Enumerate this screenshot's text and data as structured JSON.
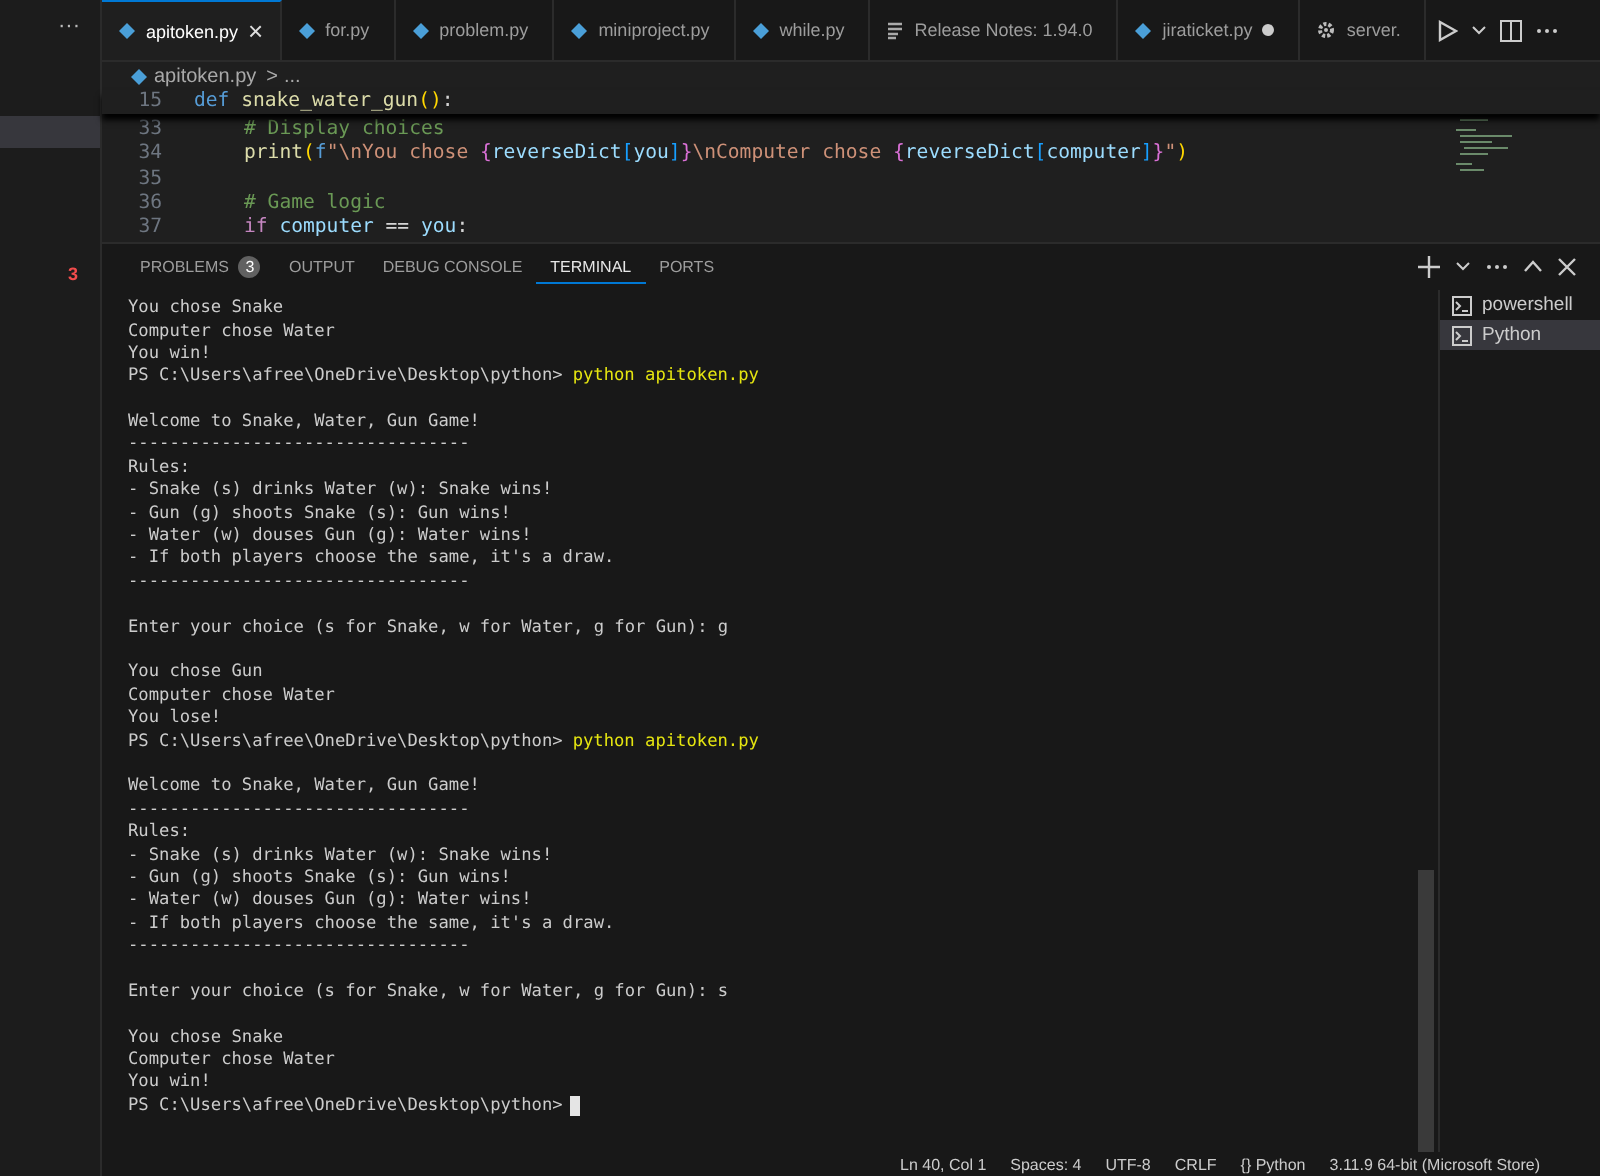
{
  "sidebar": {
    "more": "···",
    "badge": "3"
  },
  "tabs": [
    {
      "label": "apitoken.py",
      "kind": "python",
      "selected": true,
      "modified": false,
      "closable": true,
      "close": "×"
    },
    {
      "label": "for.py",
      "kind": "python",
      "selected": false,
      "modified": false,
      "closable": false
    },
    {
      "label": "problem.py",
      "kind": "python",
      "selected": false,
      "modified": false,
      "closable": false
    },
    {
      "label": "miniproject.py",
      "kind": "python",
      "selected": false,
      "modified": false,
      "closable": false
    },
    {
      "label": "while.py",
      "kind": "python",
      "selected": false,
      "modified": false,
      "closable": false
    },
    {
      "label": "Release Notes: 1.94.0",
      "kind": "notes",
      "selected": false,
      "modified": false,
      "closable": false
    },
    {
      "label": "jiraticket.py",
      "kind": "python",
      "selected": false,
      "modified": true,
      "closable": false
    },
    {
      "label": "server.",
      "kind": "settings",
      "selected": false,
      "modified": false,
      "closable": false
    }
  ],
  "breadcrumb": {
    "file": "apitoken.py",
    "separator": ">",
    "rest": "..."
  },
  "code_lines": [
    {
      "number": "15",
      "sticky": true,
      "indented": false,
      "tokens": [
        {
          "kind": "keyword",
          "text": "def "
        },
        {
          "kind": "function",
          "text": "snake_water_gun"
        },
        {
          "kind": "bracket",
          "text": "()"
        },
        {
          "kind": "plain",
          "text": ":"
        }
      ]
    },
    {
      "number": "33",
      "sticky": false,
      "indented": true,
      "tokens": [
        {
          "kind": "comment",
          "text": "# Display choices"
        }
      ]
    },
    {
      "number": "34",
      "sticky": false,
      "indented": true,
      "tokens": [
        {
          "kind": "function",
          "text": "print"
        },
        {
          "kind": "bracket",
          "text": "("
        },
        {
          "kind": "keyword",
          "text": "f"
        },
        {
          "kind": "string",
          "text": "\"\\nYou chose "
        },
        {
          "kind": "brace",
          "text": "{"
        },
        {
          "kind": "variable",
          "text": "reverseDict"
        },
        {
          "kind": "bracket2",
          "text": "["
        },
        {
          "kind": "variable",
          "text": "you"
        },
        {
          "kind": "bracket2",
          "text": "]"
        },
        {
          "kind": "brace",
          "text": "}"
        },
        {
          "kind": "string",
          "text": "\\nComputer chose "
        },
        {
          "kind": "brace",
          "text": "{"
        },
        {
          "kind": "variable",
          "text": "reverseDict"
        },
        {
          "kind": "bracket2",
          "text": "["
        },
        {
          "kind": "variable",
          "text": "computer"
        },
        {
          "kind": "bracket2",
          "text": "]"
        },
        {
          "kind": "brace",
          "text": "}"
        },
        {
          "kind": "string",
          "text": "\""
        },
        {
          "kind": "bracket",
          "text": ")"
        }
      ]
    },
    {
      "number": "35",
      "sticky": false
    },
    {
      "number": "36",
      "sticky": false,
      "indented": true,
      "tokens": [
        {
          "kind": "comment",
          "text": "# Game logic"
        }
      ]
    },
    {
      "number": "37",
      "sticky": false,
      "indented": true,
      "tokens": [
        {
          "kind": "control",
          "text": "if "
        },
        {
          "kind": "variable",
          "text": "computer"
        },
        {
          "kind": "plain",
          "text": " == "
        },
        {
          "kind": "variable",
          "text": "you"
        },
        {
          "kind": "plain",
          "text": ":"
        }
      ]
    }
  ],
  "panel_tabs": [
    {
      "label": "PROBLEMS",
      "count": "3",
      "selected": false
    },
    {
      "label": "OUTPUT",
      "selected": false
    },
    {
      "label": "DEBUG CONSOLE",
      "selected": false
    },
    {
      "label": "TERMINAL",
      "selected": true
    },
    {
      "label": "PORTS",
      "selected": false
    }
  ],
  "terminal": {
    "cursor": true,
    "lines": [
      {
        "kind": "text",
        "text": "You chose Snake"
      },
      {
        "kind": "text",
        "text": "Computer chose Water"
      },
      {
        "kind": "text",
        "text": "You win!"
      },
      {
        "kind": "prompt",
        "text": "PS C:\\Users\\afree\\OneDrive\\Desktop\\python>",
        "command": "python apitoken.py"
      },
      {
        "kind": "blank"
      },
      {
        "kind": "text",
        "text": "Welcome to Snake, Water, Gun Game!"
      },
      {
        "kind": "text",
        "text": "---------------------------------"
      },
      {
        "kind": "text",
        "text": "Rules:"
      },
      {
        "kind": "text",
        "text": "- Snake (s) drinks Water (w): Snake wins!"
      },
      {
        "kind": "text",
        "text": "- Gun (g) shoots Snake (s): Gun wins!"
      },
      {
        "kind": "text",
        "text": "- Water (w) douses Gun (g): Water wins!"
      },
      {
        "kind": "text",
        "text": "- If both players choose the same, it's a draw."
      },
      {
        "kind": "text",
        "text": "---------------------------------"
      },
      {
        "kind": "blank"
      },
      {
        "kind": "text",
        "text": "Enter your choice (s for Snake, w for Water, g for Gun): g"
      },
      {
        "kind": "blank"
      },
      {
        "kind": "text",
        "text": "You chose Gun"
      },
      {
        "kind": "text",
        "text": "Computer chose Water"
      },
      {
        "kind": "text",
        "text": "You lose!"
      },
      {
        "kind": "prompt",
        "text": "PS C:\\Users\\afree\\OneDrive\\Desktop\\python>",
        "command": "python apitoken.py"
      },
      {
        "kind": "blank"
      },
      {
        "kind": "text",
        "text": "Welcome to Snake, Water, Gun Game!"
      },
      {
        "kind": "text",
        "text": "---------------------------------"
      },
      {
        "kind": "text",
        "text": "Rules:"
      },
      {
        "kind": "text",
        "text": "- Snake (s) drinks Water (w): Snake wins!"
      },
      {
        "kind": "text",
        "text": "- Gun (g) shoots Snake (s): Gun wins!"
      },
      {
        "kind": "text",
        "text": "- Water (w) douses Gun (g): Water wins!"
      },
      {
        "kind": "text",
        "text": "- If both players choose the same, it's a draw."
      },
      {
        "kind": "text",
        "text": "---------------------------------"
      },
      {
        "kind": "blank"
      },
      {
        "kind": "text",
        "text": "Enter your choice (s for Snake, w for Water, g for Gun): s"
      },
      {
        "kind": "blank"
      },
      {
        "kind": "text",
        "text": "You chose Snake"
      },
      {
        "kind": "text",
        "text": "Computer chose Water"
      },
      {
        "kind": "text",
        "text": "You win!"
      },
      {
        "kind": "prompt",
        "text": "PS C:\\Users\\afree\\OneDrive\\Desktop\\python>"
      }
    ]
  },
  "terminal_list": [
    {
      "label": "powershell",
      "selected": false
    },
    {
      "label": "Python",
      "selected": true
    }
  ],
  "status_bar": [
    "Ln 40, Col 1",
    "Spaces: 4",
    "UTF-8",
    "CRLF",
    "{} Python",
    "3.11.9 64-bit (Microsoft Store)"
  ]
}
